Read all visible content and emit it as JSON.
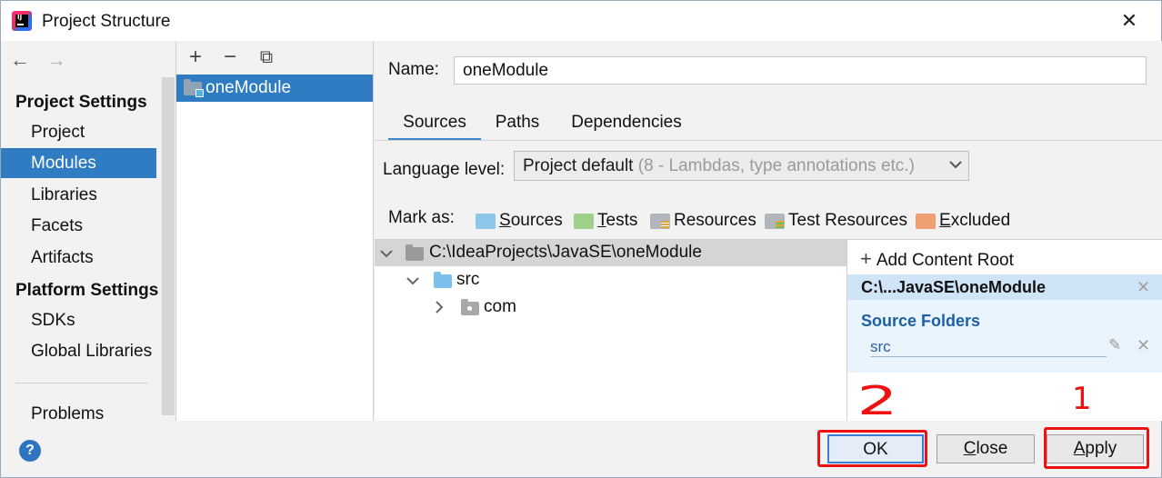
{
  "window": {
    "title": "Project Structure",
    "close_label": "✕"
  },
  "nav": {
    "back": "←",
    "forward": "→"
  },
  "sidebar": {
    "project_settings_heading": "Project Settings",
    "project_items": [
      {
        "label": "Project"
      },
      {
        "label": "Modules",
        "selected": true
      },
      {
        "label": "Libraries"
      },
      {
        "label": "Facets"
      },
      {
        "label": "Artifacts"
      }
    ],
    "platform_settings_heading": "Platform Settings",
    "platform_items": [
      {
        "label": "SDKs"
      },
      {
        "label": "Global Libraries"
      }
    ],
    "problems_label": "Problems"
  },
  "modules": {
    "toolbar": {
      "add": "+",
      "remove": "−",
      "copy": "⧉"
    },
    "items": [
      {
        "label": "oneModule",
        "selected": true
      }
    ]
  },
  "module_settings": {
    "name_label": "Name:",
    "name_value": "oneModule",
    "tabs": [
      {
        "label": "Sources",
        "active": true
      },
      {
        "label": "Paths"
      },
      {
        "label": "Dependencies"
      }
    ],
    "language_level_label": "Language level:",
    "language_level_value": "Project default",
    "language_level_hint": "(8 - Lambdas, type annotations etc.)",
    "mark_as_label": "Mark as:",
    "mark_as": [
      {
        "label": "Sources",
        "color": "#8cc6e8"
      },
      {
        "label": "Tests",
        "color": "#9ed08a"
      },
      {
        "label": "Resources",
        "color": "#b0b6bc"
      },
      {
        "label": "Test Resources",
        "color": "#b0b6bc"
      },
      {
        "label": "Excluded",
        "color": "#f0a070"
      }
    ]
  },
  "tree": {
    "root": "C:\\IdeaProjects\\JavaSE\\oneModule",
    "src": "src",
    "com": "com"
  },
  "content_roots": {
    "add_label": "Add Content Root",
    "root_path": "C:\\...JavaSE\\oneModule",
    "source_folders_title": "Source Folders",
    "source_folder": "src"
  },
  "footer": {
    "help": "?",
    "ok": "OK",
    "close": "Close",
    "apply": "Apply"
  },
  "annotations": {
    "label_ok": "2",
    "label_apply": "1"
  },
  "colors": {
    "selection": "#2f7cc2",
    "annotation": "#ee1111"
  }
}
